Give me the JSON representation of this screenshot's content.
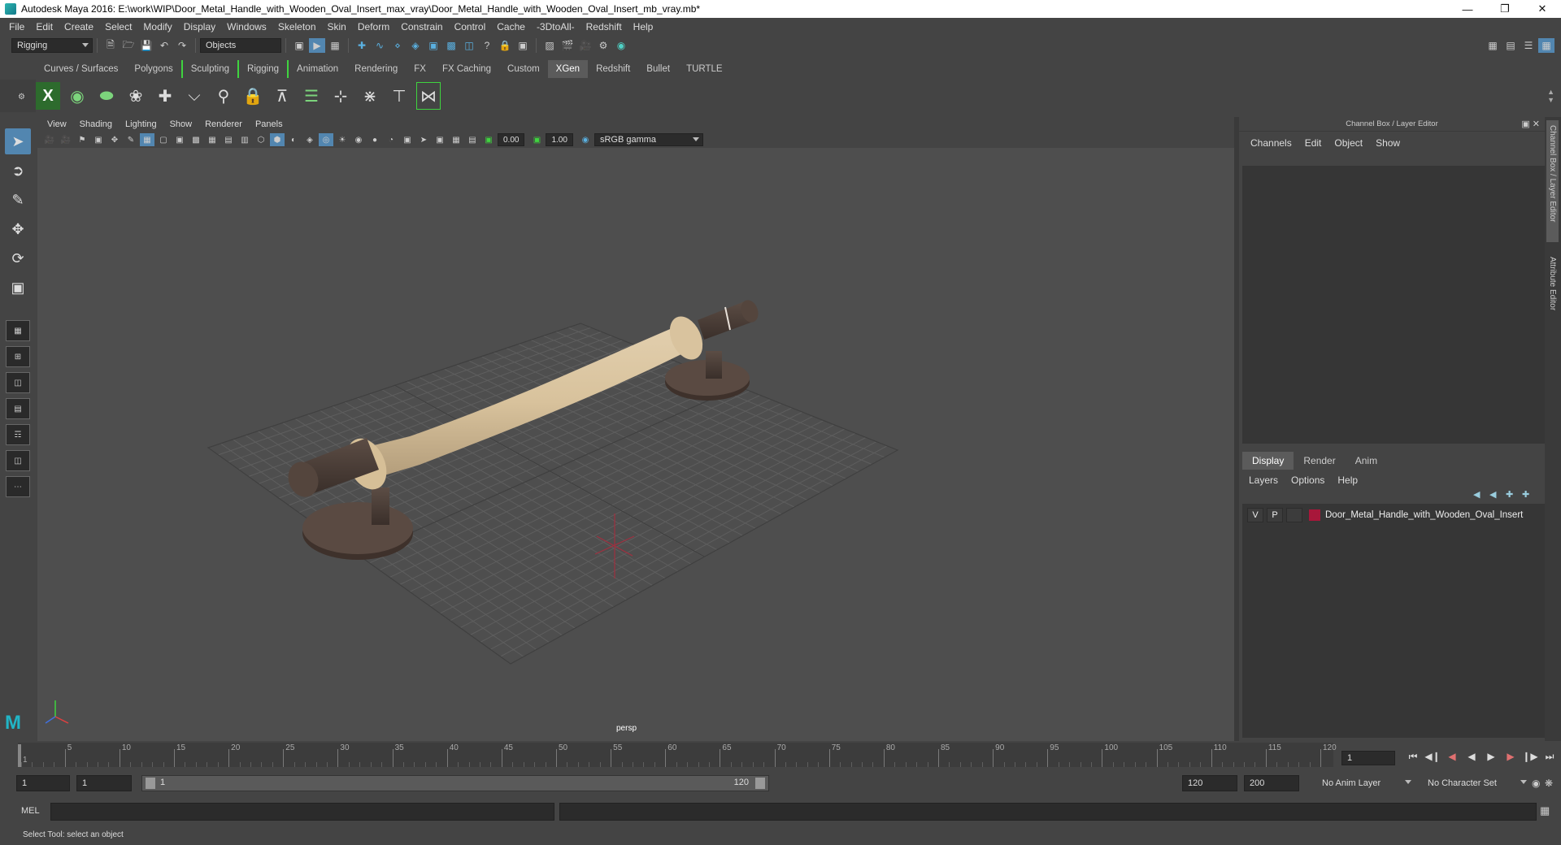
{
  "window": {
    "title": "Autodesk Maya 2016: E:\\work\\WIP\\Door_Metal_Handle_with_Wooden_Oval_Insert_max_vray\\Door_Metal_Handle_with_Wooden_Oval_Insert_mb_vray.mb*"
  },
  "menubar": [
    "File",
    "Edit",
    "Create",
    "Select",
    "Modify",
    "Display",
    "Windows",
    "Skeleton",
    "Skin",
    "Deform",
    "Constrain",
    "Control",
    "Cache",
    "-3DtoAll-",
    "Redshift",
    "Help"
  ],
  "statusline": {
    "menuset": "Rigging",
    "selmode": "Objects"
  },
  "shelf_tabs": [
    "Curves / Surfaces",
    "Polygons",
    "Sculpting",
    "Rigging",
    "Animation",
    "Rendering",
    "FX",
    "FX Caching",
    "Custom",
    "XGen",
    "Redshift",
    "Bullet",
    "TURTLE"
  ],
  "active_shelf": "XGen",
  "viewport": {
    "menu": [
      "View",
      "Shading",
      "Lighting",
      "Show",
      "Renderer",
      "Panels"
    ],
    "exposure": "0.00",
    "gamma": "1.00",
    "color_space": "sRGB gamma",
    "camera": "persp"
  },
  "channel_box": {
    "title": "Channel Box / Layer Editor",
    "menu": [
      "Channels",
      "Edit",
      "Object",
      "Show"
    ]
  },
  "layer_editor": {
    "tabs": [
      "Display",
      "Render",
      "Anim"
    ],
    "active_tab": "Display",
    "menu": [
      "Layers",
      "Options",
      "Help"
    ],
    "layers": [
      {
        "v": "V",
        "p": "P",
        "name": "Door_Metal_Handle_with_Wooden_Oval_Insert",
        "color": "#a8173a"
      }
    ]
  },
  "side_tabs": [
    "Channel Box / Layer Editor",
    "Attribute Editor"
  ],
  "timeline": {
    "ticks": [
      "5",
      "10",
      "15",
      "20",
      "25",
      "30",
      "35",
      "40",
      "45",
      "50",
      "55",
      "60",
      "65",
      "70",
      "75",
      "80",
      "85",
      "90",
      "95",
      "100",
      "105",
      "110",
      "115",
      "120"
    ],
    "start_label": "1",
    "current_frame": "1"
  },
  "range": {
    "start": "1",
    "playback_start": "1",
    "slider_start": "1",
    "slider_end": "120",
    "playback_end": "120",
    "end": "200",
    "anim_layer": "No Anim Layer",
    "character_set": "No Character Set"
  },
  "mel": {
    "label": "MEL"
  },
  "help_line": "Select Tool: select an object"
}
